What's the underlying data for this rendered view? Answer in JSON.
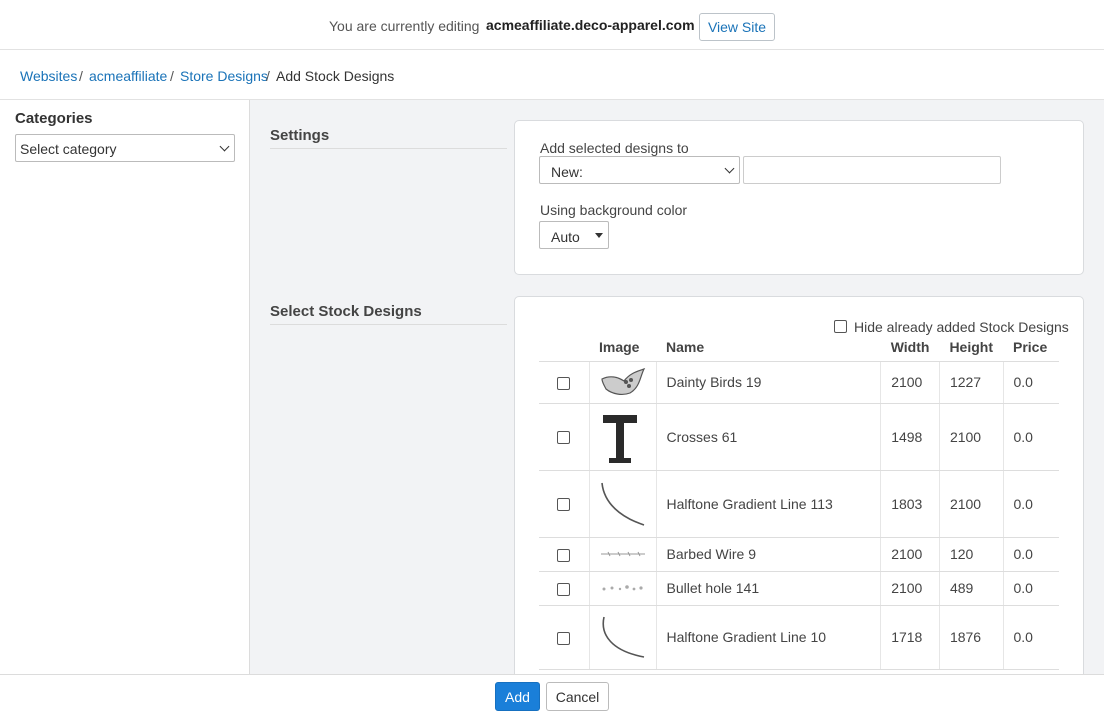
{
  "topbar": {
    "editing_text": "You are currently editing",
    "site_name": "acmeaffiliate.deco-apparel.com",
    "view_site_label": "View Site"
  },
  "breadcrumb": {
    "items": [
      "Websites",
      "acmeaffiliate",
      "Store Designs"
    ],
    "current": "Add Stock Designs",
    "separator": "/"
  },
  "sidebar": {
    "title": "Categories",
    "select_value": "Select category"
  },
  "settings": {
    "section_title": "Settings",
    "add_to_label": "Add selected designs to",
    "add_to_value": "New:",
    "new_name_value": "",
    "bg_label": "Using background color",
    "bg_value": "Auto"
  },
  "designs": {
    "section_title": "Select Stock Designs",
    "hide_label": "Hide already added Stock Designs",
    "columns": [
      "Image",
      "Name",
      "Width",
      "Height",
      "Price"
    ],
    "rows": [
      {
        "name": "Dainty Birds 19",
        "width": "2100",
        "height": "1227",
        "price": "0.0",
        "icon": "bird-icon"
      },
      {
        "name": "Crosses 61",
        "width": "1498",
        "height": "2100",
        "price": "0.0",
        "icon": "cross-icon"
      },
      {
        "name": "Halftone Gradient Line 113",
        "width": "1803",
        "height": "2100",
        "price": "0.0",
        "icon": "curve-line-icon"
      },
      {
        "name": "Barbed Wire 9",
        "width": "2100",
        "height": "120",
        "price": "0.0",
        "icon": "barbed-wire-icon"
      },
      {
        "name": "Bullet hole 141",
        "width": "2100",
        "height": "489",
        "price": "0.0",
        "icon": "bullet-hole-icon"
      },
      {
        "name": "Halftone Gradient Line 10",
        "width": "1718",
        "height": "1876",
        "price": "0.0",
        "icon": "curve-line-icon"
      }
    ]
  },
  "footer": {
    "add_label": "Add",
    "cancel_label": "Cancel"
  },
  "colors": {
    "link": "#1a73b8",
    "primary_button": "#1a7fd9",
    "main_background": "#f2f3f5"
  }
}
